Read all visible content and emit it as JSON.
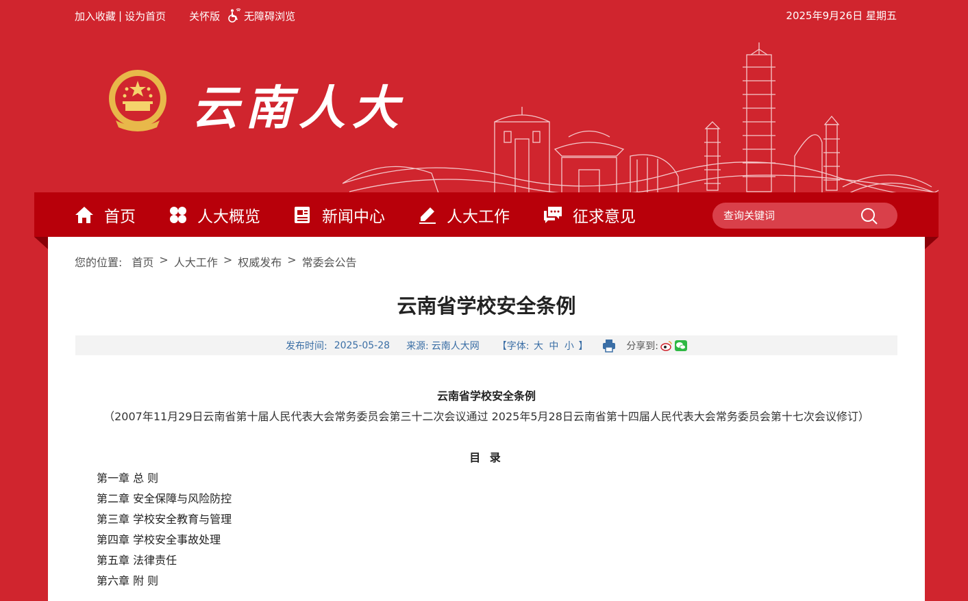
{
  "topbar": {
    "bookmark": "加入收藏",
    "separator": "|",
    "homepage": "设为首页",
    "care_mode": "关怀版",
    "accessibility": "无障碍浏览",
    "date": "2025年9月26日 星期五"
  },
  "header": {
    "site_title": "云南人大"
  },
  "nav": {
    "items": [
      {
        "label": "首页",
        "icon": "home-icon"
      },
      {
        "label": "人大概览",
        "icon": "grid-icon"
      },
      {
        "label": "新闻中心",
        "icon": "news-icon"
      },
      {
        "label": "人大工作",
        "icon": "pencil-icon"
      },
      {
        "label": "征求意见",
        "icon": "chat-icon"
      }
    ],
    "search_placeholder": "查询关键词"
  },
  "breadcrumb": {
    "label": "您的位置:",
    "items": [
      "首页",
      "人大工作",
      "权威发布",
      "常委会公告"
    ],
    "arrow": ">"
  },
  "article": {
    "title": "云南省学校安全条例",
    "meta": {
      "publish_label": "发布时间:",
      "publish_date": "2025-05-28",
      "source_label": "来源:",
      "source": "云南人大网",
      "font_open": "【字体:",
      "font_large": "大",
      "font_medium": "中",
      "font_small": "小",
      "font_close": "】",
      "share_label": "分享到:"
    },
    "doc_title": "云南省学校安全条例",
    "doc_subtitle": "（2007年11月29日云南省第十届人民代表大会常务委员会第三十二次会议通过 2025年5月28日云南省第十四届人民代表大会常务委员会第十七次会议修订）",
    "toc_title": "目 录",
    "toc": [
      "第一章 总 则",
      "第二章 安全保障与风险防控",
      "第三章 学校安全教育与管理",
      "第四章 学校安全事故处理",
      "第五章 法律责任",
      "第六章 附 则"
    ]
  },
  "colors": {
    "brand_red": "#d0252e",
    "nav_red": "#b8000a",
    "meta_blue": "#3a6ea5"
  }
}
